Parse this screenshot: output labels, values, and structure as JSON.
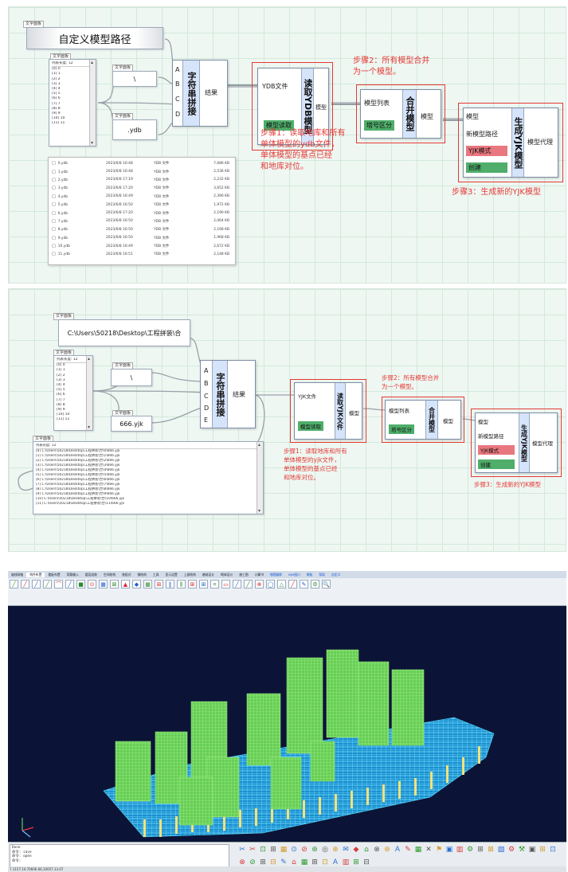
{
  "panel1": {
    "label_widget_caption": "文字面板",
    "title_text": "自定义模型路径",
    "list_caption": "文字面板",
    "list_header": "列表长度: 12",
    "list_items": [
      "[0] 0",
      "[1] 1",
      "[2] 2",
      "[3] 3",
      "[4] 4",
      "[5] 5",
      "[6] 6",
      "[7] 7",
      "[8] 8",
      "[9] 9",
      "[10] 10",
      "[11] 11"
    ],
    "sep_caption": "文字面板",
    "sep_value": "\\",
    "ext_caption": "文字面板",
    "ext_value": ".ydb",
    "concat_title": "字符串拼接",
    "concat_ports": [
      "A",
      "B",
      "C",
      "D"
    ],
    "concat_output": "结果",
    "read_title": "读取YDB模型",
    "read_in1": "YDB文件",
    "read_in2": "模型读取",
    "read_out": "模型",
    "merge_title": "合并模型",
    "merge_in1": "模型列表",
    "merge_in2": "塔号区分",
    "merge_out": "模型",
    "gen_title": "生成YJK模型",
    "gen_in1": "模型",
    "gen_in2": "新模型路径",
    "gen_in3": "YJK模式",
    "gen_in4": "创建",
    "gen_out": "模型代理",
    "step1": [
      "步骤1：读取地库和所有",
      "单体模型的ydb文件，",
      "单体模型的基点已经",
      "和地库对位。"
    ],
    "step2": [
      "步骤2：所有模型合并",
      "为一个模型。"
    ],
    "step3": "步骤3：生成新的YJK模型",
    "files": [
      {
        "name": "0.ydb",
        "date": "2023/6/8 16:48",
        "type": "YDB 文件",
        "size": "7,686 KB"
      },
      {
        "name": "1.ydb",
        "date": "2023/6/8 16:48",
        "type": "YDB 文件",
        "size": "2,536 KB"
      },
      {
        "name": "2.ydb",
        "date": "2023/6/8 17:19",
        "type": "YDB 文件",
        "size": "2,232 KB"
      },
      {
        "name": "3.ydb",
        "date": "2023/6/8 17:20",
        "type": "YDB 文件",
        "size": "3,652 KB"
      },
      {
        "name": "4.ydb",
        "date": "2023/6/8 16:49",
        "type": "YDB 文件",
        "size": "2,390 KB"
      },
      {
        "name": "5.ydb",
        "date": "2023/6/8 16:50",
        "type": "YDB 文件",
        "size": "1,972 KB"
      },
      {
        "name": "6.ydb",
        "date": "2023/6/8 17:20",
        "type": "YDB 文件",
        "size": "2,190 KB"
      },
      {
        "name": "7.ydb",
        "date": "2023/6/8 16:50",
        "type": "YDB 文件",
        "size": "2,064 KB"
      },
      {
        "name": "8.ydb",
        "date": "2023/6/8 16:50",
        "type": "YDB 文件",
        "size": "2,168 KB"
      },
      {
        "name": "9.ydb",
        "date": "2023/6/8 16:50",
        "type": "YDB 文件",
        "size": "1,968 KB"
      },
      {
        "name": "10.ydb",
        "date": "2023/6/8 16:49",
        "type": "YDB 文件",
        "size": "2,672 KB"
      },
      {
        "name": "11.ydb",
        "date": "2023/6/8 16:51",
        "type": "YDB 文件",
        "size": "2,148 KB"
      }
    ]
  },
  "panel2": {
    "path_caption": "文字面板",
    "path_value": "C:\\Users\\50218\\Desktop\\工程拼装\\合",
    "list_caption": "文字面板",
    "list_header": "列表长度: 12",
    "list_items": [
      "[0] 0",
      "[1] 1",
      "[2] 2",
      "[3] 3",
      "[4] 4",
      "[5] 5",
      "[6] 6",
      "[7] 7",
      "[8] 8",
      "[9] 9",
      "[10] 10",
      "[11] 11"
    ],
    "sep_caption": "文字面板",
    "sep_value": "\\",
    "ext_caption": "文字面板",
    "ext_value": "666.yjk",
    "concat_title": "字符串拼接",
    "concat_ports": [
      "A",
      "B",
      "C",
      "D",
      "E"
    ],
    "concat_output": "结果",
    "read_title": "读取YJK文件",
    "read_in1": "YJK文件",
    "read_in2": "模型读取",
    "read_out": "模型",
    "merge_title": "合并模型",
    "merge_in1": "模型列表",
    "merge_in2": "塔号区分",
    "merge_out": "模型",
    "gen_title": "生成YJK模型",
    "gen_in1": "模型",
    "gen_in2": "新模型路径",
    "gen_in3": "YJK模式",
    "gen_in4": "创建",
    "gen_out": "模型代理",
    "step1": [
      "步骤1：读取地库和所有",
      "单体模型的yjk文件，",
      "单体模型的基点已经",
      "和地库对位。"
    ],
    "step2": [
      "步骤2：所有模型合并",
      "为一个模型。"
    ],
    "step3": "步骤3：生成新的YJK模型",
    "result_caption": "文字面板",
    "result_header": "列表长度: 12",
    "result_items": [
      "[0]  C:\\Users\\50218\\Desktop\\工程拼装\\合\\0\\666.yjk",
      "[1]  C:\\Users\\50218\\Desktop\\工程拼装\\合\\1\\666.yjk",
      "[2]  C:\\Users\\50218\\Desktop\\工程拼装\\合\\2\\666.yjk",
      "[3]  C:\\Users\\50218\\Desktop\\工程拼装\\合\\3\\666.yjk",
      "[4]  C:\\Users\\50218\\Desktop\\工程拼装\\合\\4\\666.yjk",
      "[5]  C:\\Users\\50218\\Desktop\\工程拼装\\合\\5\\666.yjk",
      "[6]  C:\\Users\\50218\\Desktop\\工程拼装\\合\\6\\666.yjk",
      "[7]  C:\\Users\\50218\\Desktop\\工程拼装\\合\\7\\666.yjk",
      "[8]  C:\\Users\\50218\\Desktop\\工程拼装\\合\\8\\666.yjk",
      "[9]  C:\\Users\\50218\\Desktop\\工程拼装\\合\\9\\666.yjk",
      "[10]  C:\\Users\\50218\\Desktop\\工程拼装\\合\\10\\666.yjk",
      "[11]  C:\\Users\\50218\\Desktop\\工程拼装\\合\\11\\666.yjk"
    ]
  },
  "cad": {
    "menu_tabs": [
      "轴线网格",
      "构件布置",
      "楼板布置",
      "荷载输入",
      "楼层组装",
      "空间结构",
      "装配式",
      "钢结构",
      "工具",
      "显示设置",
      "上部结构",
      "基础设计",
      "砌体设计",
      "施工图",
      "计算书",
      "钢筋翻样",
      "BIM接口",
      "模板",
      "帮助",
      "自定义"
    ],
    "active_tab": 1,
    "command_lines": [
      "Done",
      "命令: save",
      "命令: open",
      "命令:"
    ],
    "status_text": "7.1157.10.70606.66,10057.13.07"
  }
}
